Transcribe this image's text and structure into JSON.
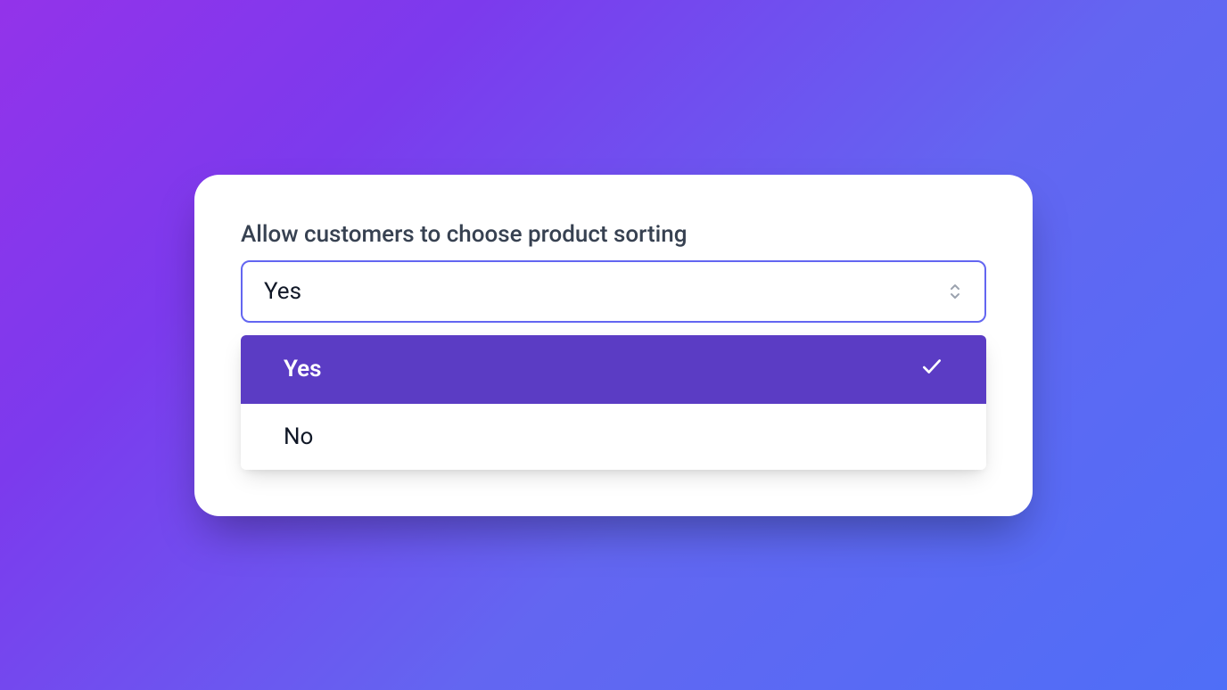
{
  "form": {
    "label": "Allow customers to choose product sorting",
    "selected_value": "Yes",
    "options": [
      {
        "label": "Yes",
        "selected": true
      },
      {
        "label": "No",
        "selected": false
      }
    ]
  }
}
